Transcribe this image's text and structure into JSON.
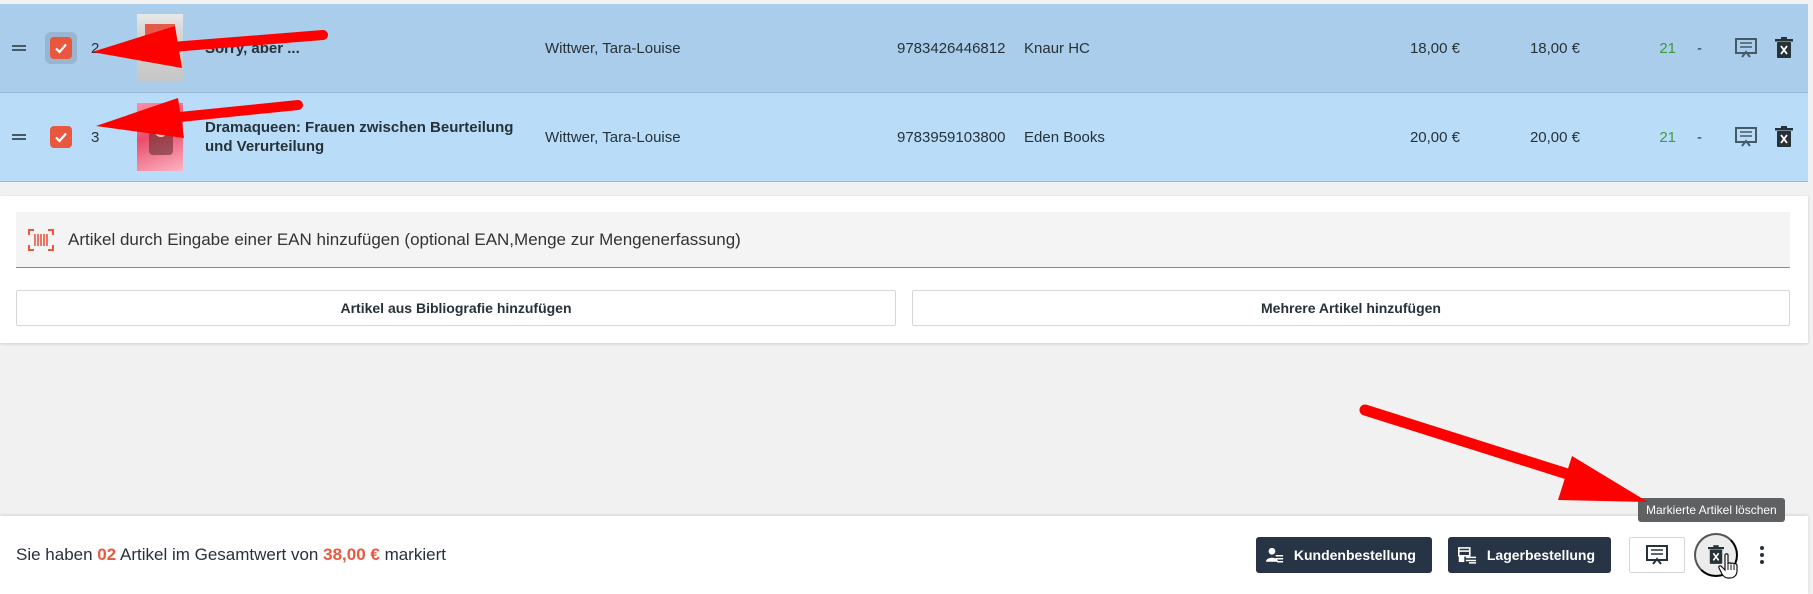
{
  "rows": [
    {
      "position": "2",
      "title": "Sorry, aber ...",
      "author": "Wittwer, Tara-Louise",
      "ean": "9783426446812",
      "publisher": "Knaur HC",
      "price_single": "18,00 €",
      "price_total": "18,00 €",
      "stock": "21",
      "dash": "-"
    },
    {
      "position": "3",
      "title": "Dramaqueen: Frauen zwischen Beurteilung und Verurteilung",
      "author": "Wittwer, Tara-Louise",
      "ean": "9783959103800",
      "publisher": "Eden Books",
      "price_single": "20,00 €",
      "price_total": "20,00 €",
      "stock": "21",
      "dash": "-"
    }
  ],
  "ean_input": {
    "placeholder": "Artikel durch Eingabe einer EAN hinzufügen (optional EAN,Menge zur Mengenerfassung)"
  },
  "buttons": {
    "bibliography": "Artikel aus Bibliografie hinzufügen",
    "multiple": "Mehrere Artikel hinzufügen",
    "customer_order": "Kundenbestellung",
    "stock_order": "Lagerbestellung"
  },
  "footer": {
    "text_prefix": "Sie haben ",
    "count": "02",
    "text_middle": " Artikel im Gesamtwert von ",
    "total": "38,00 €",
    "text_suffix": " markiert"
  },
  "tooltip": "Markierte Artikel löschen",
  "colors": {
    "accent": "#e9573f",
    "row_selected_1": "#a9cdea",
    "row_selected_2": "#b9dcf8",
    "dark_button": "#263445",
    "stock_green": "#3e9b3e",
    "annotation_arrow": "#ff0000"
  },
  "icons": {
    "drag": "drag-handle-icon",
    "checkbox": "checkmark-icon",
    "barcode": "barcode-icon",
    "note": "note-icon",
    "delete": "delete-icon",
    "customer": "customer-order-icon",
    "stock": "stock-order-icon",
    "more": "more-vertical-icon"
  }
}
